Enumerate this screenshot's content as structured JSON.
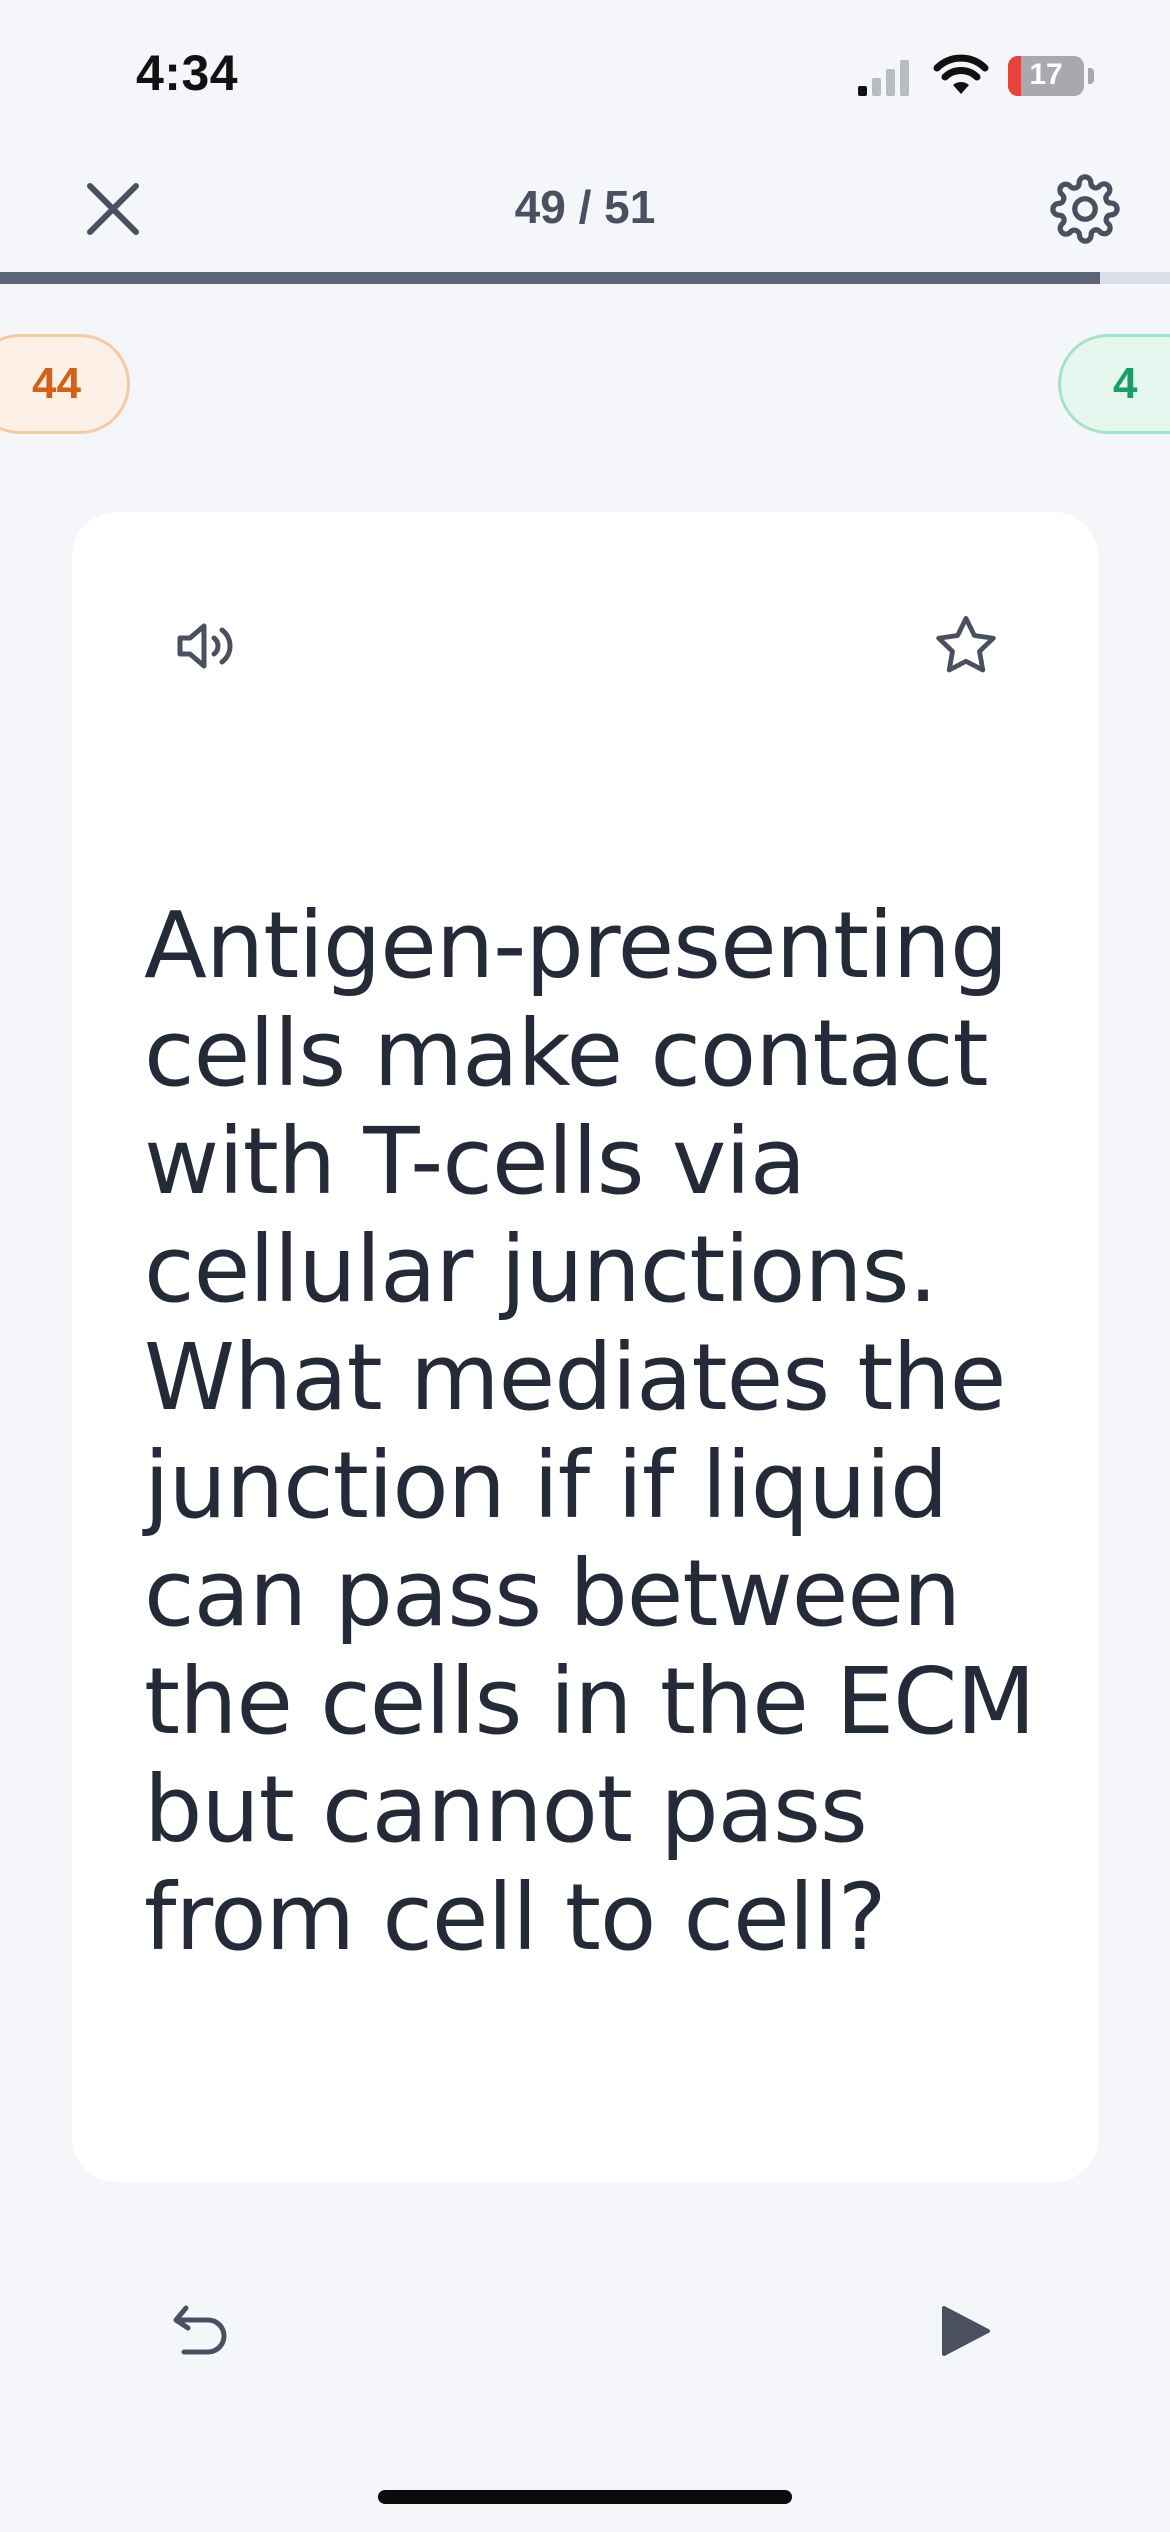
{
  "status_bar": {
    "time": "4:34",
    "battery_level": "17",
    "battery_color": "#e5443d",
    "icons": [
      "signal-icon",
      "wifi-icon",
      "battery-icon"
    ]
  },
  "header": {
    "progress_label": "49 / 51",
    "progress_fraction": 0.94,
    "icons": [
      "close-icon",
      "gear-icon"
    ]
  },
  "counters": {
    "still_learning": "44",
    "know": "4",
    "still_learning_color": "#d45f17",
    "know_color": "#1b9d67"
  },
  "card": {
    "text": "Antigen-presenting cells make contact with T-cells via cellular junctions. What mediates the junction if if liquid can pass between the cells in the ECM but cannot pass from cell to cell?",
    "icons": [
      "speaker-icon",
      "star-icon"
    ]
  },
  "controls": {
    "icons": [
      "undo-icon",
      "play-icon"
    ]
  }
}
